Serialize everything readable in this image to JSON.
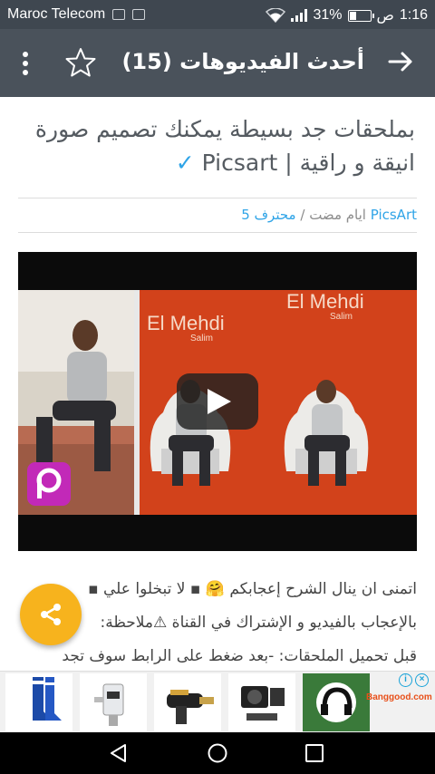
{
  "status_bar": {
    "carrier": "Maroc Telecom",
    "battery": "31%",
    "battery_level": 0.31,
    "am_pm": "ص",
    "time": "1:16"
  },
  "app_bar": {
    "title": "أحدث الفيديوهات (15)",
    "icons": [
      "arrow-right-icon",
      "star-outline-icon",
      "more-vertical-icon"
    ]
  },
  "article": {
    "headline": "بملحقات جد بسيطة يمكنك تصميم صورة انيقة و راقية | Picsart",
    "verified_mark": "✓",
    "author": "PicsArt",
    "time_ago": "ايام مضت",
    "separator": "/",
    "category": "محترف 5",
    "video": {
      "poster_title": "El Mehdi",
      "poster_subtitle": "Salim",
      "logo": "picsart-logo"
    },
    "body_lines": [
      "اتمنى ان ينال الشرح إعجابكم 🤗 ▪ لا تبخلوا علي ▪",
      "بالإعجاب بالفيديو و الإشتراك في القناة ⚠ملاحظة:",
      "قبل تحميل الملحقات: -بعد ضغط على الرابط سوف تجد"
    ]
  },
  "ads": {
    "brand_logo": "Banggood.com",
    "tiles": [
      "football-socks",
      "water-timer",
      "power-drill",
      "action-camera",
      "sports-headphones"
    ]
  },
  "colors": {
    "status_bar": "#3f4750",
    "app_bar": "#4a525b",
    "accent": "#2fa4e7",
    "fab": "#f7b31d",
    "poster_orange": "#d2421b"
  }
}
